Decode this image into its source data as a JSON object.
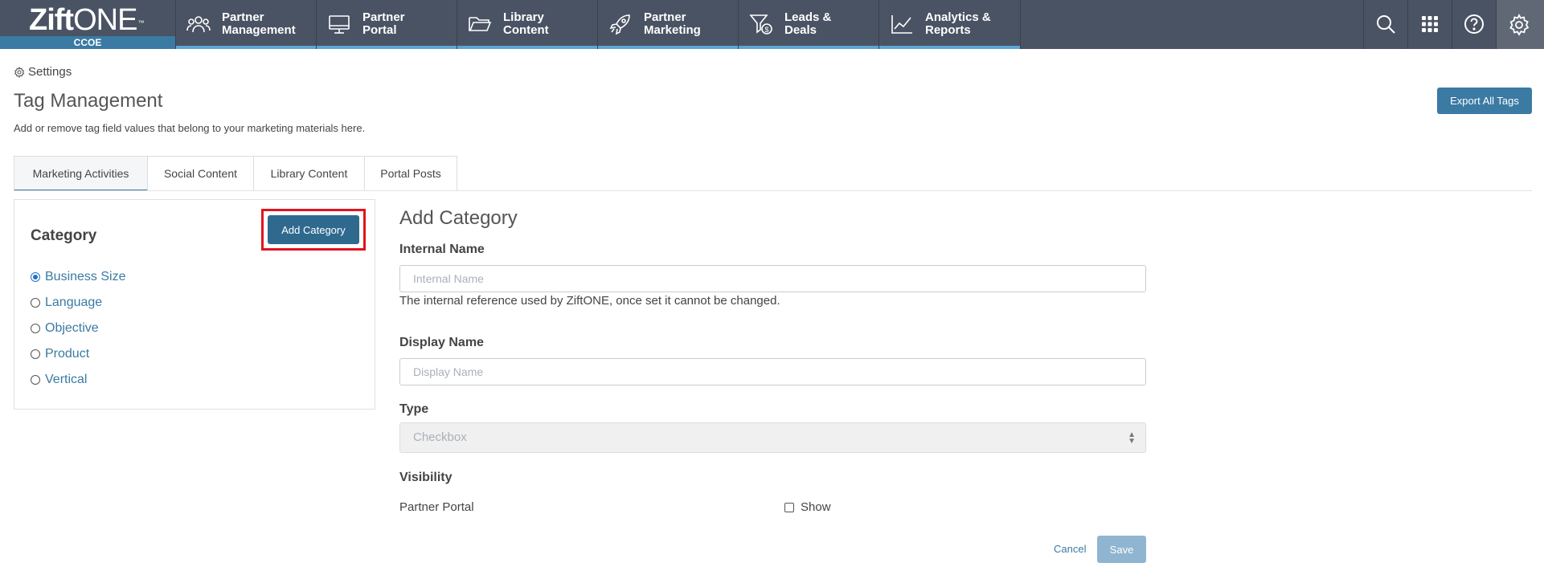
{
  "brand": {
    "logo_bold": "Zift",
    "logo_light": "ONE",
    "logo_tm": "™",
    "workspace": "CCOE"
  },
  "nav": [
    {
      "label": "Partner\nManagement",
      "icon": "people-icon"
    },
    {
      "label": "Partner\nPortal",
      "icon": "monitor-icon"
    },
    {
      "label": "Library\nContent",
      "icon": "folder-icon"
    },
    {
      "label": "Partner\nMarketing",
      "icon": "rocket-icon"
    },
    {
      "label": "Leads &\nDeals",
      "icon": "funnel-dollar-icon"
    },
    {
      "label": "Analytics &\nReports",
      "icon": "line-chart-icon"
    }
  ],
  "utilities": [
    "search-icon",
    "apps-grid-icon",
    "help-icon",
    "gear-icon"
  ],
  "breadcrumb": {
    "label": "Settings"
  },
  "page": {
    "title": "Tag Management",
    "subtitle": "Add or remove tag field values that belong to your marketing materials here.",
    "export_label": "Export All Tags"
  },
  "tabs": [
    "Marketing Activities",
    "Social Content",
    "Library Content",
    "Portal Posts"
  ],
  "active_tab": "Marketing Activities",
  "category_panel": {
    "title": "Category",
    "add_label": "Add Category",
    "items": [
      "Business Size",
      "Language",
      "Objective",
      "Product",
      "Vertical"
    ],
    "selected": "Business Size"
  },
  "form": {
    "title": "Add Category",
    "internal_name_label": "Internal Name",
    "internal_name_placeholder": "Internal Name",
    "internal_name_value": "",
    "internal_name_help": "The internal reference used by ZiftONE, once set it cannot be changed.",
    "display_name_label": "Display Name",
    "display_name_placeholder": "Display Name",
    "display_name_value": "",
    "type_label": "Type",
    "type_value": "Checkbox",
    "visibility_label": "Visibility",
    "partner_portal_label": "Partner Portal",
    "show_label": "Show",
    "show_checked": false,
    "cancel_label": "Cancel",
    "save_label": "Save"
  },
  "colors": {
    "nav_bg": "#4a5363",
    "accent": "#3a7aa3",
    "highlight_outline": "#e0141e"
  }
}
